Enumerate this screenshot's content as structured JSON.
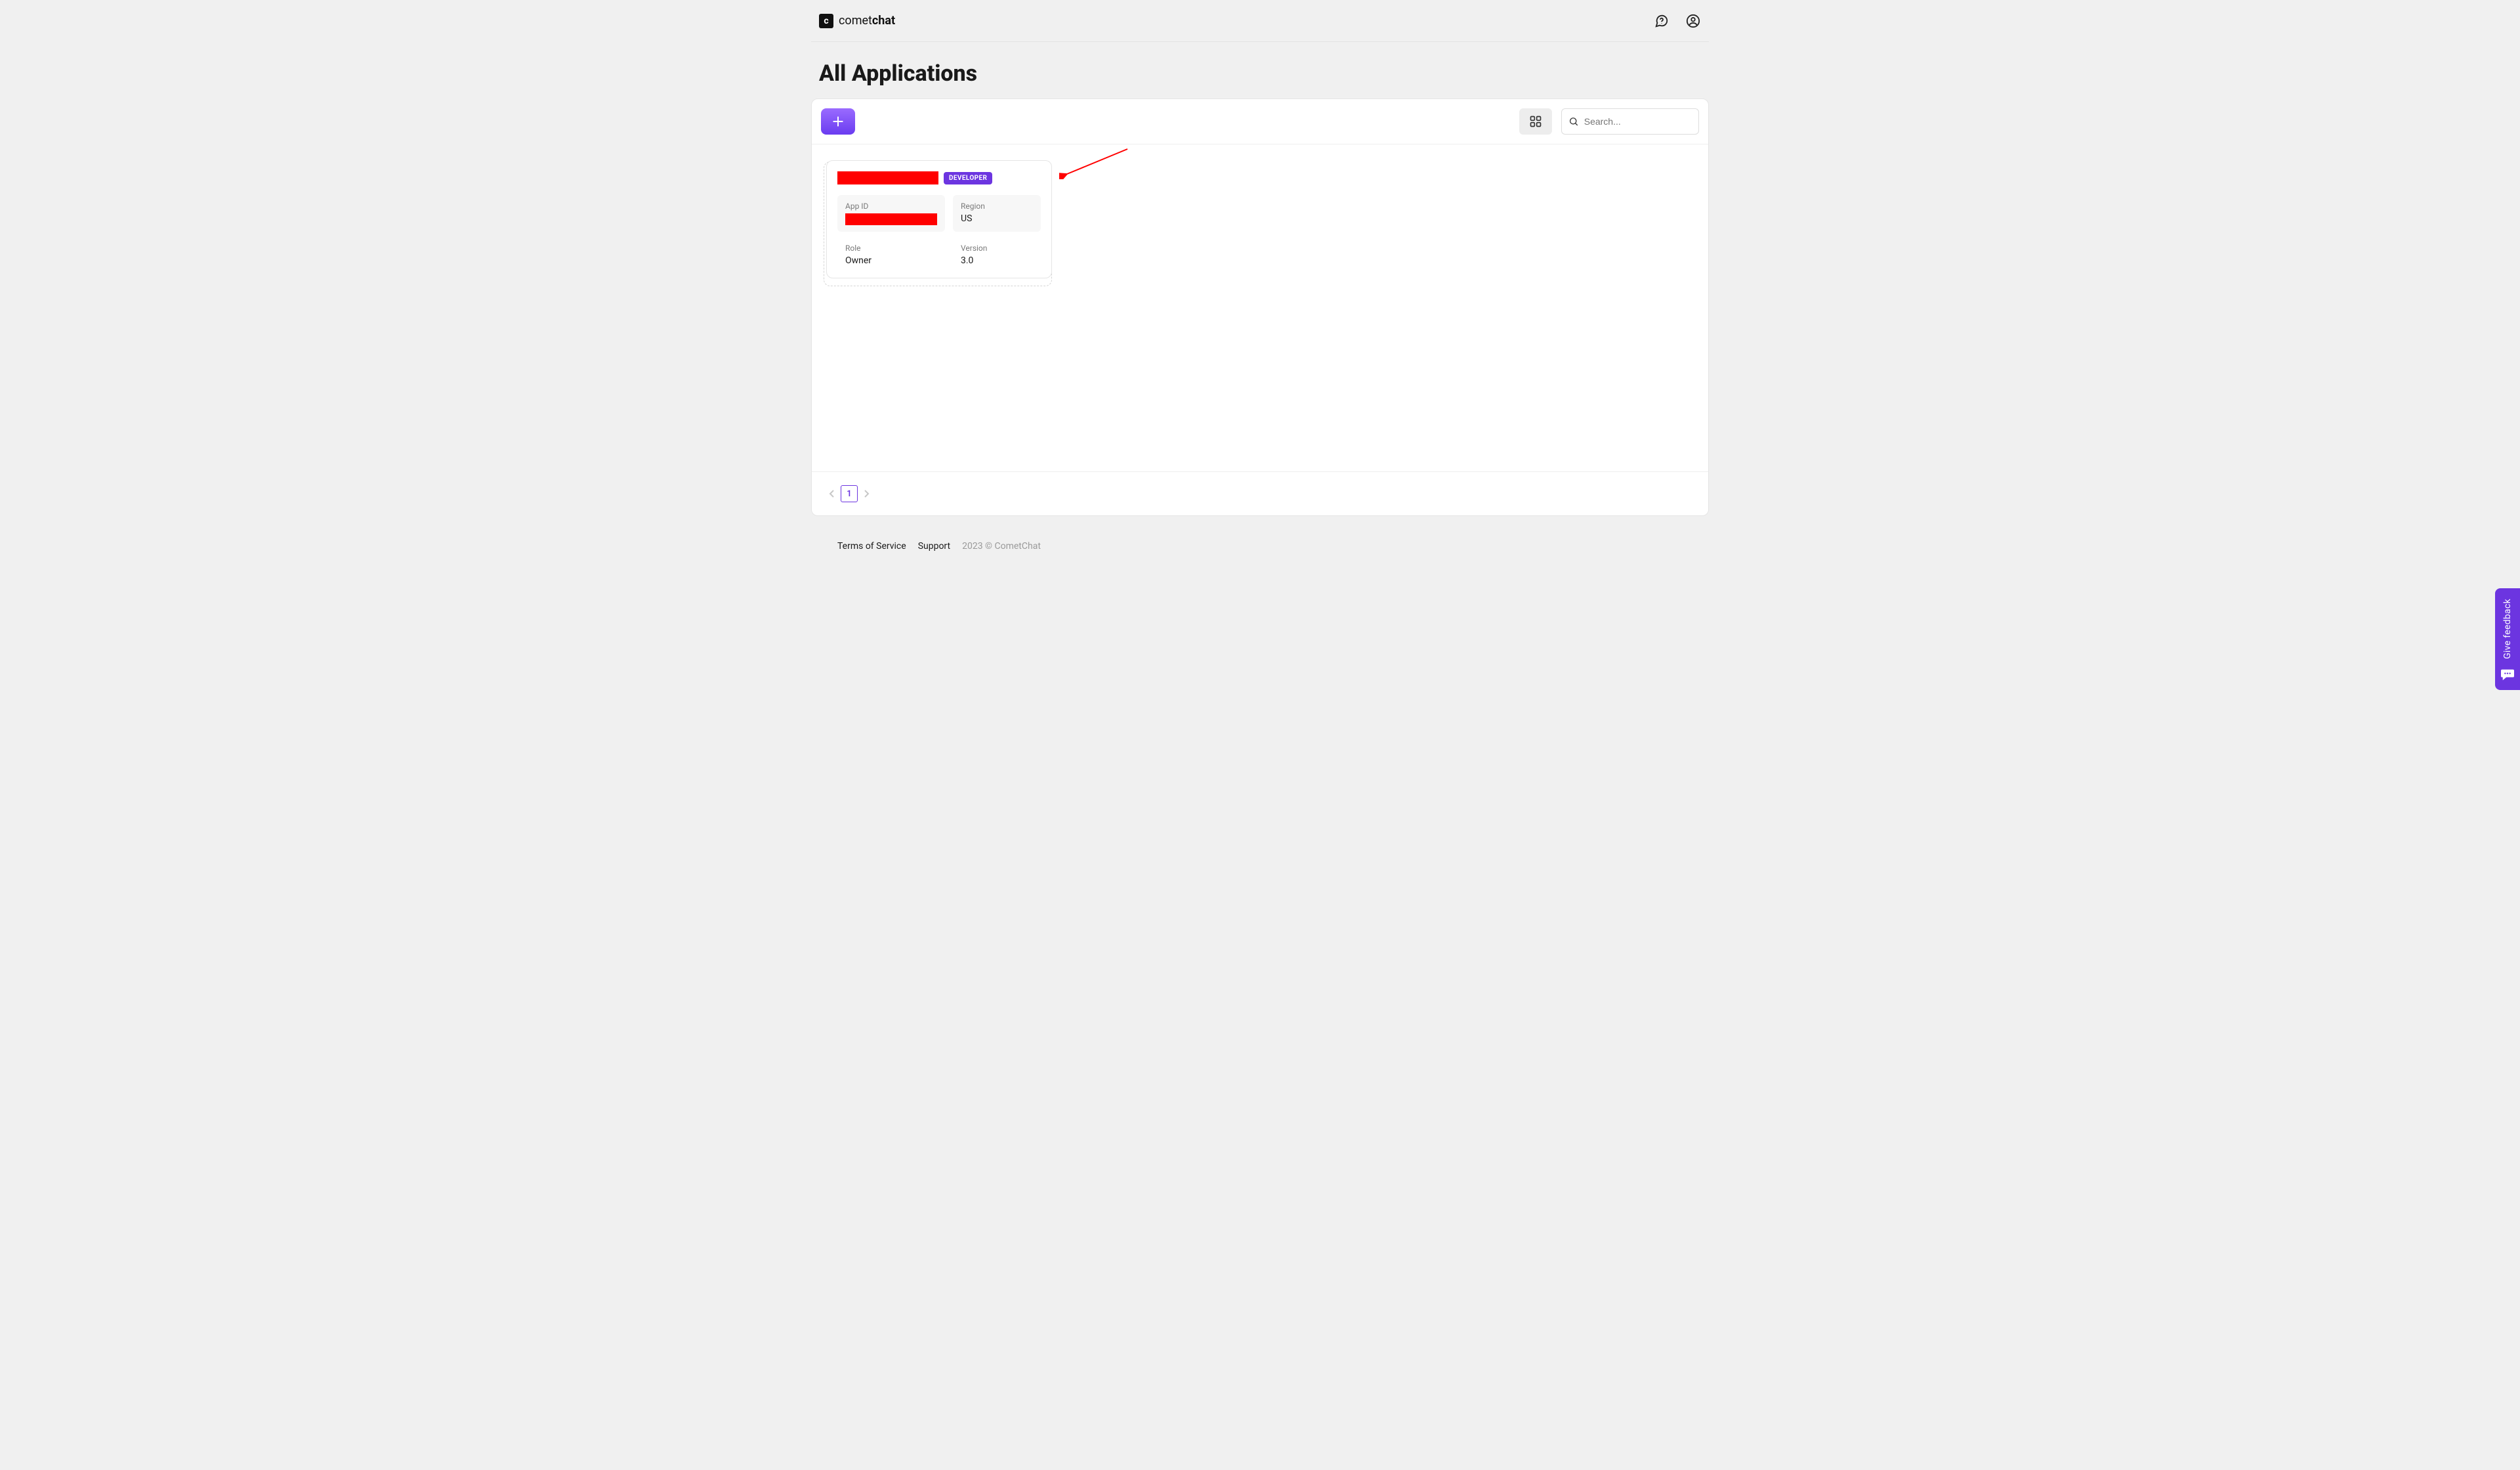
{
  "header": {
    "brand_prefix": "comet",
    "brand_suffix": "chat",
    "logo_letter": "c"
  },
  "page": {
    "title": "All Applications"
  },
  "toolbar": {
    "search_placeholder": "Search..."
  },
  "app_card": {
    "badge": "DEVELOPER",
    "meta": {
      "app_id_label": "App ID",
      "region_label": "Region",
      "region_value": "US",
      "role_label": "Role",
      "role_value": "Owner",
      "version_label": "Version",
      "version_value": "3.0"
    }
  },
  "pagination": {
    "current_page": "1"
  },
  "footer": {
    "terms": "Terms of Service",
    "support": "Support",
    "copyright": "2023 © CometChat"
  },
  "feedback": {
    "label": "Give feedback"
  }
}
